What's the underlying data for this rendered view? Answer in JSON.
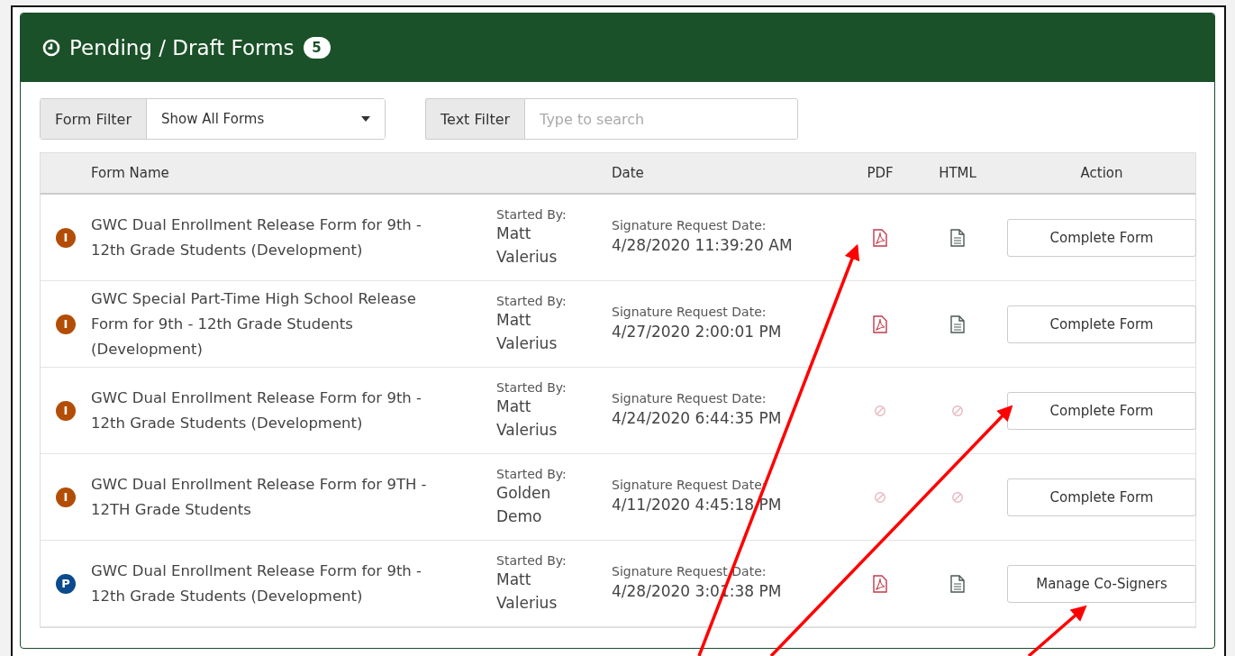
{
  "panel": {
    "title": "Pending / Draft Forms",
    "count": "5"
  },
  "filters": {
    "form_filter": {
      "label": "Form Filter",
      "value": "Show All Forms"
    },
    "text_filter": {
      "label": "Text Filter",
      "placeholder": "Type to search"
    }
  },
  "table": {
    "columns": [
      "Form Name",
      "Date",
      "PDF",
      "HTML",
      "Action"
    ],
    "rows": [
      {
        "status": "I",
        "color": "#b34d06",
        "name": "GWC Dual Enrollment Release Form for 9th - 12th Grade Students (Development)",
        "started_label": "Started By:",
        "started_by": "Matt Valerius",
        "date_label": "Signature Request Date:",
        "date": "4/28/2020 11:39:20 AM",
        "pdf_available": true,
        "html_available": true,
        "action": "Complete Form"
      },
      {
        "status": "I",
        "color": "#b34d06",
        "name": "GWC Special Part-Time High School Release Form for 9th - 12th Grade Students (Development)",
        "started_label": "Started By:",
        "started_by": "Matt Valerius",
        "date_label": "Signature Request Date:",
        "date": "4/27/2020 2:00:01 PM",
        "pdf_available": true,
        "html_available": true,
        "action": "Complete Form"
      },
      {
        "status": "I",
        "color": "#b34d06",
        "name": "GWC Dual Enrollment Release Form for 9th - 12th Grade Students (Development)",
        "started_label": "Started By:",
        "started_by": "Matt Valerius",
        "date_label": "Signature Request Date:",
        "date": "4/24/2020 6:44:35 PM",
        "pdf_available": false,
        "html_available": false,
        "action": "Complete Form"
      },
      {
        "status": "I",
        "color": "#b34d06",
        "name": "GWC Dual Enrollment Release Form for 9TH - 12TH Grade Students",
        "started_label": "Started By:",
        "started_by": "Golden Demo",
        "date_label": "Signature Request Date:",
        "date": "4/11/2020 4:45:18 PM",
        "pdf_available": false,
        "html_available": false,
        "action": "Complete Form"
      },
      {
        "status": "P",
        "color": "#0b4a8c",
        "name": "GWC Dual Enrollment Release Form for 9th - 12th Grade Students (Development)",
        "started_label": "Started By:",
        "started_by": "Matt Valerius",
        "date_label": "Signature Request Date:",
        "date": "4/28/2020 3:01:38 PM",
        "pdf_available": true,
        "html_available": true,
        "action": "Manage Co-Signers"
      }
    ]
  }
}
